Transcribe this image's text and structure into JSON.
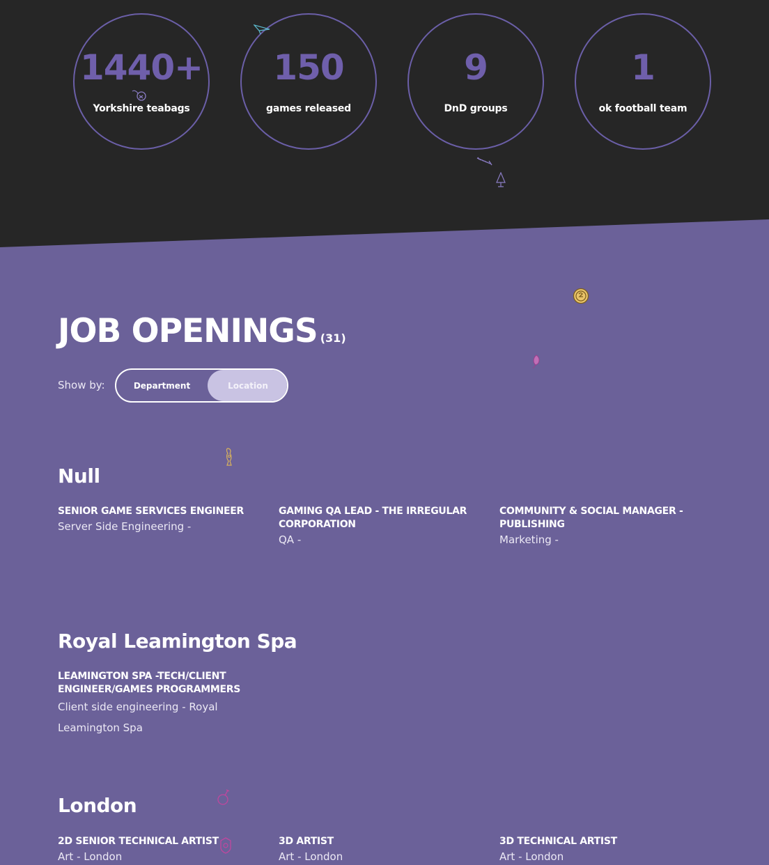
{
  "stats": [
    {
      "number": "1440+",
      "label": "Yorkshire teabags"
    },
    {
      "number": "150",
      "label": "games released"
    },
    {
      "number": "9",
      "label": "DnD groups"
    },
    {
      "number": "1",
      "label": "ok football team"
    }
  ],
  "jobs": {
    "title": "JOB OPENINGS",
    "count": "(31)",
    "show_by_label": "Show by:",
    "toggle": {
      "department": "Department",
      "location": "Location"
    }
  },
  "groups": [
    {
      "name": "Null",
      "jobs": [
        {
          "title": "SENIOR GAME SERVICES ENGINEER",
          "meta": "Server Side Engineering -"
        },
        {
          "title": "GAMING QA LEAD - THE IRREGULAR CORPORATION",
          "meta": "QA -"
        },
        {
          "title": "COMMUNITY & SOCIAL MANAGER - PUBLISHING",
          "meta": "Marketing -"
        }
      ]
    },
    {
      "name": "Royal Leamington Spa",
      "jobs": [
        {
          "title": "LEAMINGTON SPA -TECH/CLIENT ENGINEER/GAMES PROGRAMMERS",
          "meta": "Client side engineering - Royal Leamington Spa"
        }
      ]
    },
    {
      "name": "London",
      "jobs": [
        {
          "title": "2D SENIOR TECHNICAL ARTIST",
          "meta": "Art - London"
        },
        {
          "title": "3D ARTIST",
          "meta": "Art - London"
        },
        {
          "title": "3D TECHNICAL ARTIST",
          "meta": "Art - London"
        }
      ]
    }
  ],
  "icons": [
    "paper-plane-icon",
    "sheep-icon",
    "sword-icon",
    "tree-icon",
    "coin-icon",
    "leaf-icon",
    "figure-icon",
    "bomb-icon",
    "shield-icon"
  ],
  "colors": {
    "dark_bg": "#262626",
    "purple_bg": "#6b6199",
    "accent": "#6f5fab",
    "toggle_active": "#c9c3e3"
  }
}
